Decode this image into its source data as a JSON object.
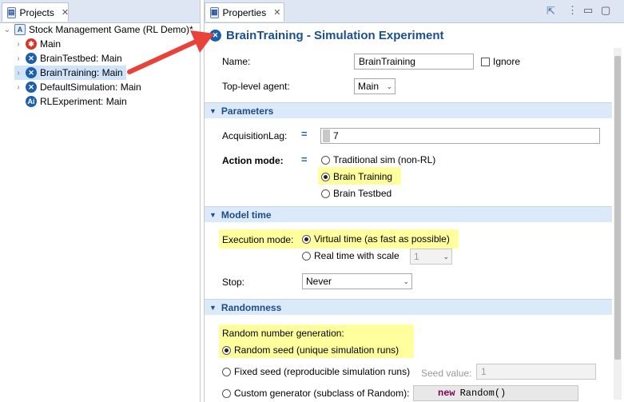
{
  "projects_tab": {
    "label": "Projects"
  },
  "tree": {
    "root": "Stock Management Game (RL Demo)*",
    "items": [
      {
        "label": "Main",
        "icon": "agent-icon"
      },
      {
        "label": "BrainTestbed: Main",
        "icon": "experiment-icon"
      },
      {
        "label": "BrainTraining: Main",
        "icon": "experiment-icon",
        "selected": true
      },
      {
        "label": "DefaultSimulation: Main",
        "icon": "experiment-icon"
      },
      {
        "label": "RLExperiment: Main",
        "icon": "rl-experiment-icon"
      }
    ]
  },
  "properties_tab": {
    "label": "Properties"
  },
  "header": {
    "title": "BrainTraining - Simulation Experiment"
  },
  "general": {
    "name_label": "Name:",
    "name_value": "BrainTraining",
    "ignore_label": "Ignore",
    "top_level_label": "Top-level agent:",
    "top_level_value": "Main"
  },
  "parameters": {
    "section_label": "Parameters",
    "acq_label": "AcquisitionLag:",
    "acq_value": "7",
    "action_label": "Action mode:",
    "options": [
      "Traditional sim (non-RL)",
      "Brain Training",
      "Brain Testbed"
    ],
    "selected": "Brain Training"
  },
  "model_time": {
    "section_label": "Model time",
    "exec_label": "Execution mode:",
    "virtual_label": "Virtual time (as fast as possible)",
    "real_label": "Real time with scale",
    "scale_value": "1",
    "stop_label": "Stop:",
    "stop_value": "Never"
  },
  "randomness": {
    "section_label": "Randomness",
    "rng_label": "Random number generation:",
    "random_seed_label": "Random seed (unique simulation runs)",
    "fixed_seed_label": "Fixed seed (reproducible simulation runs)",
    "seed_value_label": "Seed value:",
    "seed_value": "1",
    "custom_label": "Custom generator (subclass of Random):",
    "custom_kw": "new",
    "custom_code": "Random()"
  },
  "colors": {
    "accent": "#1b4f8f",
    "highlight": "#ffff9d",
    "arrow": "#e8423a"
  }
}
